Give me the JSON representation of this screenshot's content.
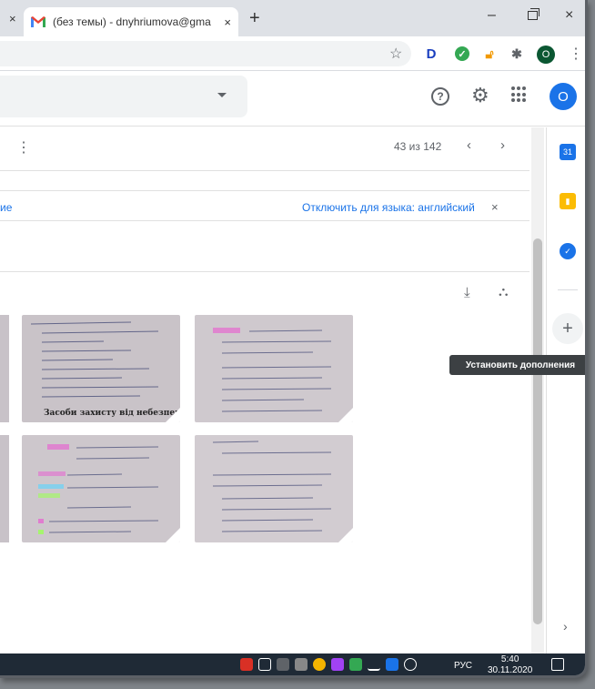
{
  "browser": {
    "tab_title": "(без темы) - dnyhriumova@gma",
    "tab_close": "×",
    "prev_tab_close": "×",
    "new_tab": "+",
    "star": "☆",
    "profile_initial": "O",
    "menu": "⋮",
    "window_min": "–",
    "window_close": "×",
    "extensions": [
      "d-icon",
      "check-icon",
      "lock-icon",
      "puzzle-icon"
    ]
  },
  "gmail": {
    "help": "?",
    "avatar_initial": "O",
    "toolbar": {
      "more": "⋮",
      "pager": "43 из 142",
      "prev": "‹",
      "next": "›"
    },
    "translate": {
      "left_fragment": "ие",
      "disable_label": "Отключить для языка: английский",
      "close": "×"
    },
    "attachment_actions": {
      "download": "⤓",
      "save_to_drive": "⛬"
    },
    "attachments": [
      {
        "name": "attachment-1",
        "heading": "Засоби захисту від небезпечних"
      },
      {
        "name": "attachment-2",
        "heading": ""
      },
      {
        "name": "attachment-3",
        "heading": ""
      },
      {
        "name": "attachment-4",
        "heading": ""
      }
    ]
  },
  "side_panel": {
    "calendar_label": "31",
    "add_label": "+",
    "tooltip": "Установить дополнения",
    "expand": "›"
  },
  "taskbar": {
    "language": "РУС",
    "time": "5:40",
    "date": "30.11.2020"
  },
  "colors": {
    "accent": "#1a73e8",
    "taskbar": "#1f2a36",
    "tab_strip": "#dee1e6"
  }
}
